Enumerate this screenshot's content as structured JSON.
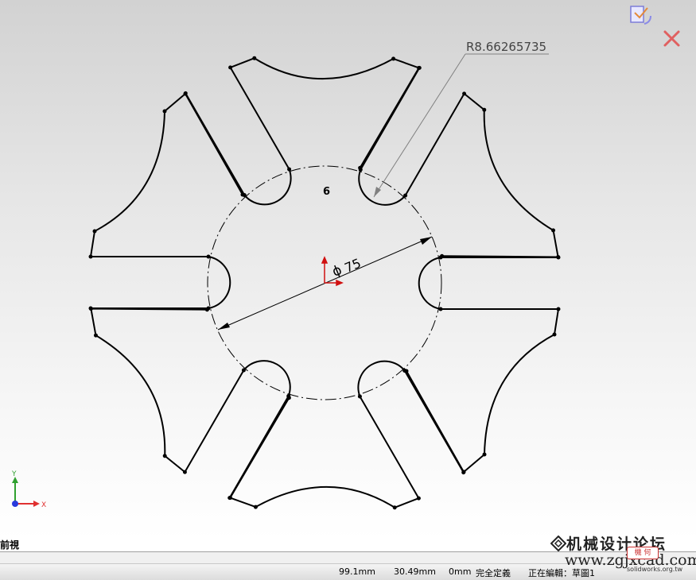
{
  "sketch": {
    "radius_dim": "R8.66265735",
    "diameter_dim": "75",
    "diameter_symbol": "ϕ",
    "pattern_count": "6"
  },
  "triad": {
    "x_label": "X",
    "y_label": "Y"
  },
  "view": {
    "orientation_label": "前視"
  },
  "status_bar": {
    "x_coord": "99.1mm",
    "y_coord": "30.49mm",
    "z_coord": "0mm",
    "definition_state": "完全定義",
    "editing_label": "正在編輯：草圖1"
  },
  "watermark": {
    "line1": "机械设计论坛",
    "line2": "www.zgjxcad.com",
    "badge": "機 何",
    "site": "solidworks.org.tw"
  },
  "colors": {
    "geometry": "#000000",
    "dimension": "#000000",
    "leader": "#808080",
    "origin": "#d01010",
    "triad_x": "#e03030",
    "triad_y": "#30a030",
    "status_bg": "#f0f0f0"
  },
  "icons": {
    "top_right_1": "rebuild-confirm-icon",
    "top_right_2": "close-sketch-icon",
    "watermark": "diamond-logo-icon"
  }
}
